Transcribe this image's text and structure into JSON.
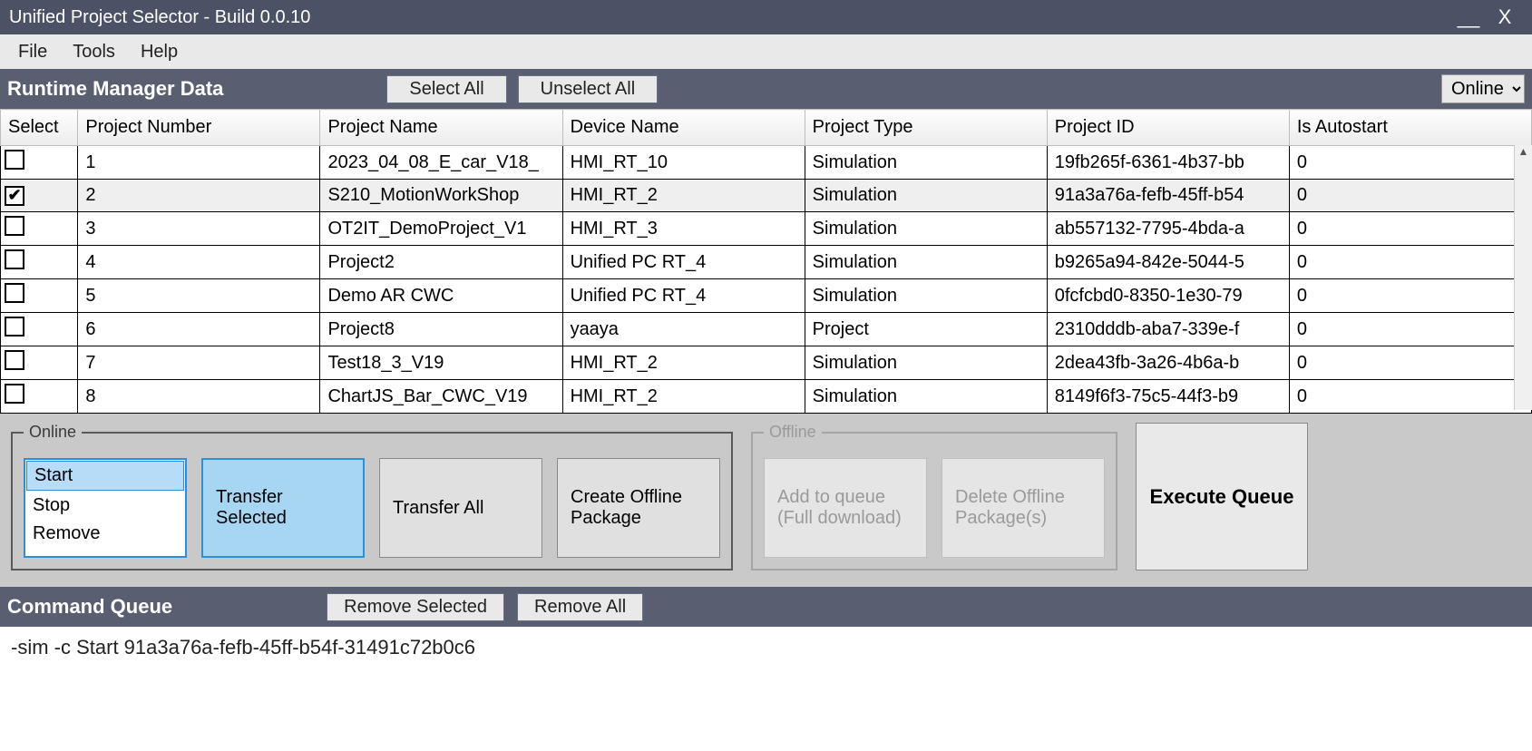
{
  "title": "Unified Project Selector - Build 0.0.10",
  "menu": {
    "file": "File",
    "tools": "Tools",
    "help": "Help"
  },
  "runtime": {
    "title": "Runtime Manager Data",
    "select_all": "Select All",
    "unselect_all": "Unselect All",
    "mode_options": [
      "Online"
    ],
    "mode_selected": "Online"
  },
  "columns": {
    "select": "Select",
    "project_number": "Project Number",
    "project_name": "Project Name",
    "device_name": "Device Name",
    "project_type": "Project Type",
    "project_id": "Project ID",
    "is_autostart": "Is Autostart"
  },
  "rows": [
    {
      "selected": false,
      "num": "1",
      "name": "2023_04_08_E_car_V18_",
      "device": "HMI_RT_10",
      "type": "Simulation",
      "id": "19fb265f-6361-4b37-bb",
      "auto": "0"
    },
    {
      "selected": true,
      "num": "2",
      "name": "S210_MotionWorkShop",
      "device": "HMI_RT_2",
      "type": "Simulation",
      "id": "91a3a76a-fefb-45ff-b54",
      "auto": "0"
    },
    {
      "selected": false,
      "num": "3",
      "name": "OT2IT_DemoProject_V1",
      "device": "HMI_RT_3",
      "type": "Simulation",
      "id": "ab557132-7795-4bda-a",
      "auto": "0"
    },
    {
      "selected": false,
      "num": "4",
      "name": "Project2",
      "device": "Unified PC RT_4",
      "type": "Simulation",
      "id": "b9265a94-842e-5044-5",
      "auto": "0"
    },
    {
      "selected": false,
      "num": "5",
      "name": "Demo AR CWC",
      "device": "Unified PC RT_4",
      "type": "Simulation",
      "id": "0fcfcbd0-8350-1e30-79",
      "auto": "0"
    },
    {
      "selected": false,
      "num": "6",
      "name": "Project8",
      "device": "yaaya",
      "type": "Project",
      "id": "2310dddb-aba7-339e-f",
      "auto": "0"
    },
    {
      "selected": false,
      "num": "7",
      "name": "Test18_3_V19",
      "device": "HMI_RT_2",
      "type": "Simulation",
      "id": "2dea43fb-3a26-4b6a-b",
      "auto": "0"
    },
    {
      "selected": false,
      "num": "8",
      "name": "ChartJS_Bar_CWC_V19",
      "device": "HMI_RT_2",
      "type": "Simulation",
      "id": "8149f6f3-75c5-44f3-b9",
      "auto": "0"
    }
  ],
  "online_group": {
    "legend": "Online",
    "list": {
      "start": "Start",
      "stop": "Stop",
      "remove": "Remove"
    },
    "transfer_selected": "Transfer Selected",
    "transfer_all": "Transfer All",
    "create_offline": "Create Offline Package"
  },
  "offline_group": {
    "legend": "Offline",
    "add_to_queue": "Add to queue (Full download)",
    "delete_offline": "Delete Offline Package(s)"
  },
  "execute_queue": "Execute Queue",
  "command_queue": {
    "title": "Command Queue",
    "remove_selected": "Remove Selected",
    "remove_all": "Remove All"
  },
  "queue_line": "-sim -c Start 91a3a76a-fefb-45ff-b54f-31491c72b0c6"
}
